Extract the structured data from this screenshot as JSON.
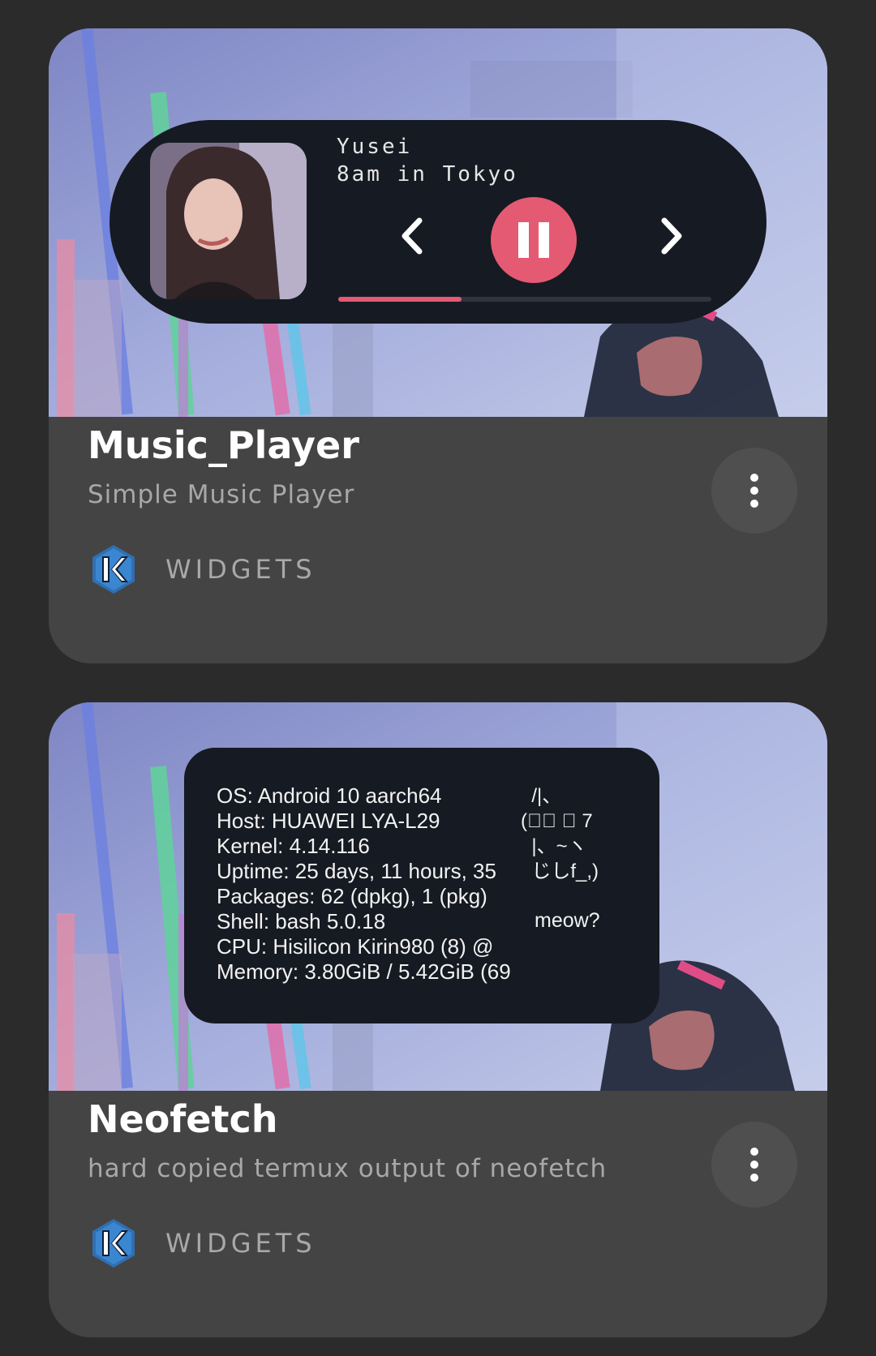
{
  "colors": {
    "page_background": "#2b2b2b",
    "card_background": "#444444",
    "widget_background": "#161a22",
    "accent_pink": "#e45a72",
    "title_text": "#ffffff",
    "secondary_text": "#a8a8a8",
    "kwgt_blue": "#2f6fb3"
  },
  "cards": [
    {
      "title": "Music_Player",
      "subtitle": "Simple Music Player",
      "category": "WIDGETS",
      "app_icon": "kwgt-logo-icon",
      "menu_icon": "more-vertical-icon",
      "preview": {
        "artist": "Yusei",
        "track": "8am in Tokyo",
        "progress": 0.33,
        "icons": {
          "previous": "chevron-left-icon",
          "play_pause": "pause-icon",
          "next": "chevron-right-icon"
        }
      }
    },
    {
      "title": "Neofetch",
      "subtitle": "hard copied termux output of neofetch",
      "category": "WIDGETS",
      "app_icon": "kwgt-logo-icon",
      "menu_icon": "more-vertical-icon",
      "preview": {
        "lines": [
          "OS: Android 10 aarch64",
          "Host: HUAWEI LYA-L29",
          "Kernel: 4.14.116",
          "Uptime: 25 days, 11 hours, 35",
          "Packages: 62 (dpkg), 1 (pkg)",
          "Shell: bash 5.0.18",
          "CPU: Hisilicon Kirin980 (8) @",
          "Memory: 3.80GiB / 5.42GiB (69"
        ],
        "ascii_art": [
          "  /|、",
          "(ﾟ､ ｡ 7",
          "  |、~ヽ",
          "  じしf_,)"
        ],
        "caption": "meow?"
      }
    }
  ]
}
